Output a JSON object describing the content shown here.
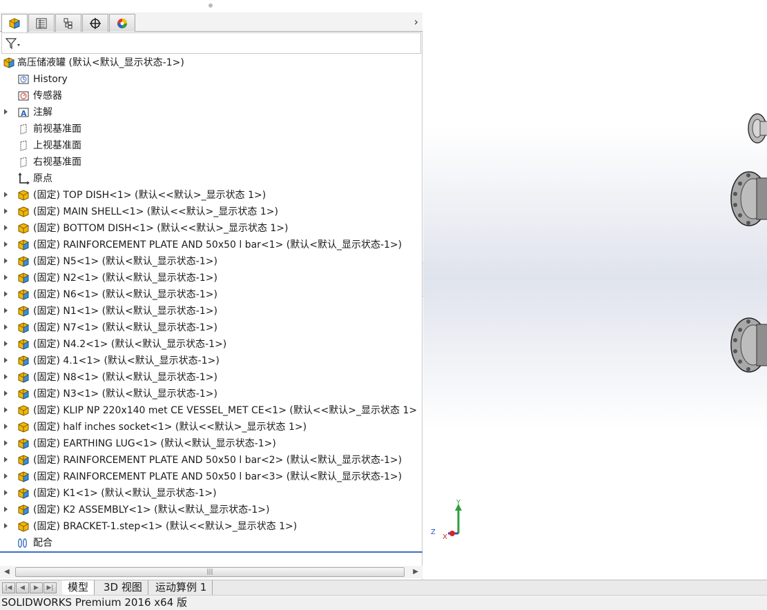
{
  "window": {
    "title": "SOLIDWORKS Premium 2016 x64 版"
  },
  "manager_tabs": [
    {
      "name": "featuremanager-tab",
      "icon": "featuremanager-icon"
    },
    {
      "name": "propertymanager-tab",
      "icon": "propertymanager-icon"
    },
    {
      "name": "configurationmanager-tab",
      "icon": "configurationmanager-icon"
    },
    {
      "name": "dimxpert-tab",
      "icon": "dimxpert-icon"
    },
    {
      "name": "display-manager-tab",
      "icon": "display-manager-icon"
    }
  ],
  "tree": {
    "root": "高压储液罐 (默认<默认_显示状态-1>)",
    "items": [
      {
        "label": "History",
        "icon": "history-icon",
        "expandable": false
      },
      {
        "label": "传感器",
        "icon": "sensor-icon",
        "expandable": false
      },
      {
        "label": "注解",
        "icon": "annotation-icon",
        "expandable": true
      },
      {
        "label": "前视基准面",
        "icon": "plane-icon",
        "expandable": false
      },
      {
        "label": "上视基准面",
        "icon": "plane-icon",
        "expandable": false
      },
      {
        "label": "右视基准面",
        "icon": "plane-icon",
        "expandable": false
      },
      {
        "label": "原点",
        "icon": "origin-icon",
        "expandable": false
      },
      {
        "label": "(固定) TOP DISH<1> (默认<<默认>_显示状态 1>)",
        "icon": "part-icon",
        "expandable": true
      },
      {
        "label": "(固定) MAIN SHELL<1> (默认<<默认>_显示状态 1>)",
        "icon": "part-icon",
        "expandable": true
      },
      {
        "label": "(固定) BOTTOM DISH<1> (默认<<默认>_显示状态 1>)",
        "icon": "part-icon",
        "expandable": true
      },
      {
        "label": "(固定) RAINFORCEMENT PLATE AND 50x50 l bar<1> (默认<默认_显示状态-1>)",
        "icon": "assembly-icon",
        "expandable": true
      },
      {
        "label": "(固定) N5<1> (默认<默认_显示状态-1>)",
        "icon": "assembly-icon",
        "expandable": true
      },
      {
        "label": "(固定) N2<1> (默认<默认_显示状态-1>)",
        "icon": "assembly-icon",
        "expandable": true
      },
      {
        "label": "(固定) N6<1> (默认<默认_显示状态-1>)",
        "icon": "assembly-icon",
        "expandable": true
      },
      {
        "label": "(固定) N1<1> (默认<默认_显示状态-1>)",
        "icon": "assembly-icon",
        "expandable": true
      },
      {
        "label": "(固定) N7<1> (默认<默认_显示状态-1>)",
        "icon": "assembly-icon",
        "expandable": true
      },
      {
        "label": "(固定) N4.2<1> (默认<默认_显示状态-1>)",
        "icon": "assembly-icon",
        "expandable": true
      },
      {
        "label": "(固定) 4.1<1> (默认<默认_显示状态-1>)",
        "icon": "assembly-icon",
        "expandable": true
      },
      {
        "label": "(固定) N8<1> (默认<默认_显示状态-1>)",
        "icon": "assembly-icon",
        "expandable": true
      },
      {
        "label": "(固定) N3<1> (默认<默认_显示状态-1>)",
        "icon": "assembly-icon",
        "expandable": true
      },
      {
        "label": "(固定) KLIP NP 220x140 met CE VESSEL_MET CE<1> (默认<<默认>_显示状态 1>",
        "icon": "part-icon",
        "expandable": true
      },
      {
        "label": "(固定) half inches socket<1> (默认<<默认>_显示状态 1>)",
        "icon": "part-icon",
        "expandable": true
      },
      {
        "label": "(固定) EARTHING LUG<1> (默认<默认_显示状态-1>)",
        "icon": "assembly-icon",
        "expandable": true
      },
      {
        "label": "(固定) RAINFORCEMENT PLATE AND 50x50 l bar<2> (默认<默认_显示状态-1>)",
        "icon": "assembly-icon",
        "expandable": true
      },
      {
        "label": "(固定) RAINFORCEMENT PLATE AND 50x50 l bar<3> (默认<默认_显示状态-1>)",
        "icon": "assembly-icon",
        "expandable": true
      },
      {
        "label": "(固定) K1<1> (默认<默认_显示状态-1>)",
        "icon": "assembly-icon",
        "expandable": true
      },
      {
        "label": "(固定) K2 ASSEMBLY<1> (默认<默认_显示状态-1>)",
        "icon": "assembly-icon",
        "expandable": true
      },
      {
        "label": "(固定) BRACKET-1.step<1> (默认<<默认>_显示状态 1>)",
        "icon": "part-icon",
        "expandable": true
      },
      {
        "label": "配合",
        "icon": "mates-icon",
        "expandable": false
      }
    ]
  },
  "viewport": {
    "triad": {
      "y": "Y",
      "z": "Z",
      "x": "X"
    }
  },
  "bottom_tabs": [
    "模型",
    "3D 视图",
    "运动算例 1"
  ],
  "colors": {
    "selection_line": "#3a6fbf",
    "part_yellow": "#f2b705",
    "assembly_blue": "#3a8fd9"
  }
}
